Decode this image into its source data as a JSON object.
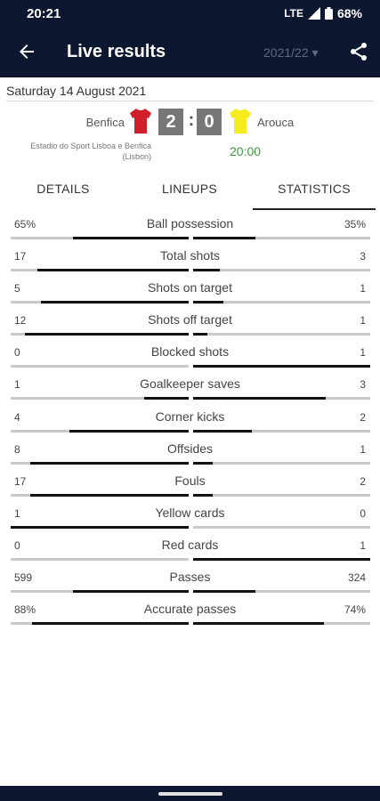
{
  "status_bar": {
    "time": "20:21",
    "network": "LTE",
    "battery": "68%"
  },
  "app_bar": {
    "title": "Live results",
    "season": "2021/22 ▾"
  },
  "match": {
    "date": "Saturday 14 August 2021",
    "home_team": "Benfica",
    "away_team": "Arouca",
    "home_score": "2",
    "away_score": "0",
    "score_separator": ":",
    "stadium": "Estadio do Sport Lisboa e Benfica (Lisbon)",
    "kickoff": "20:00",
    "colors": {
      "home_shirt": "#d01f2a",
      "away_shirt": "#f5ec1e"
    }
  },
  "tabs": [
    {
      "label": "DETAILS"
    },
    {
      "label": "LINEUPS"
    },
    {
      "label": "STATISTICS",
      "active": true
    }
  ],
  "stats": [
    {
      "label": "Ball possession",
      "home": "65%",
      "away": "35%",
      "home_frac": 0.65,
      "away_frac": 0.35
    },
    {
      "label": "Total shots",
      "home": "17",
      "away": "3",
      "home_frac": 0.85,
      "away_frac": 0.15
    },
    {
      "label": "Shots on target",
      "home": "5",
      "away": "1",
      "home_frac": 0.83,
      "away_frac": 0.17
    },
    {
      "label": "Shots off target",
      "home": "12",
      "away": "1",
      "home_frac": 0.92,
      "away_frac": 0.08
    },
    {
      "label": "Blocked shots",
      "home": "0",
      "away": "1",
      "home_frac": 0.0,
      "away_frac": 1.0
    },
    {
      "label": "Goalkeeper saves",
      "home": "1",
      "away": "3",
      "home_frac": 0.25,
      "away_frac": 0.75
    },
    {
      "label": "Corner kicks",
      "home": "4",
      "away": "2",
      "home_frac": 0.67,
      "away_frac": 0.33
    },
    {
      "label": "Offsides",
      "home": "8",
      "away": "1",
      "home_frac": 0.89,
      "away_frac": 0.11
    },
    {
      "label": "Fouls",
      "home": "17",
      "away": "2",
      "home_frac": 0.89,
      "away_frac": 0.11
    },
    {
      "label": "Yellow cards",
      "home": "1",
      "away": "0",
      "home_frac": 1.0,
      "away_frac": 0.0
    },
    {
      "label": "Red cards",
      "home": "0",
      "away": "1",
      "home_frac": 0.0,
      "away_frac": 1.0
    },
    {
      "label": "Passes",
      "home": "599",
      "away": "324",
      "home_frac": 0.65,
      "away_frac": 0.35
    },
    {
      "label": "Accurate passes",
      "home": "88%",
      "away": "74%",
      "home_frac": 0.88,
      "away_frac": 0.74
    }
  ]
}
